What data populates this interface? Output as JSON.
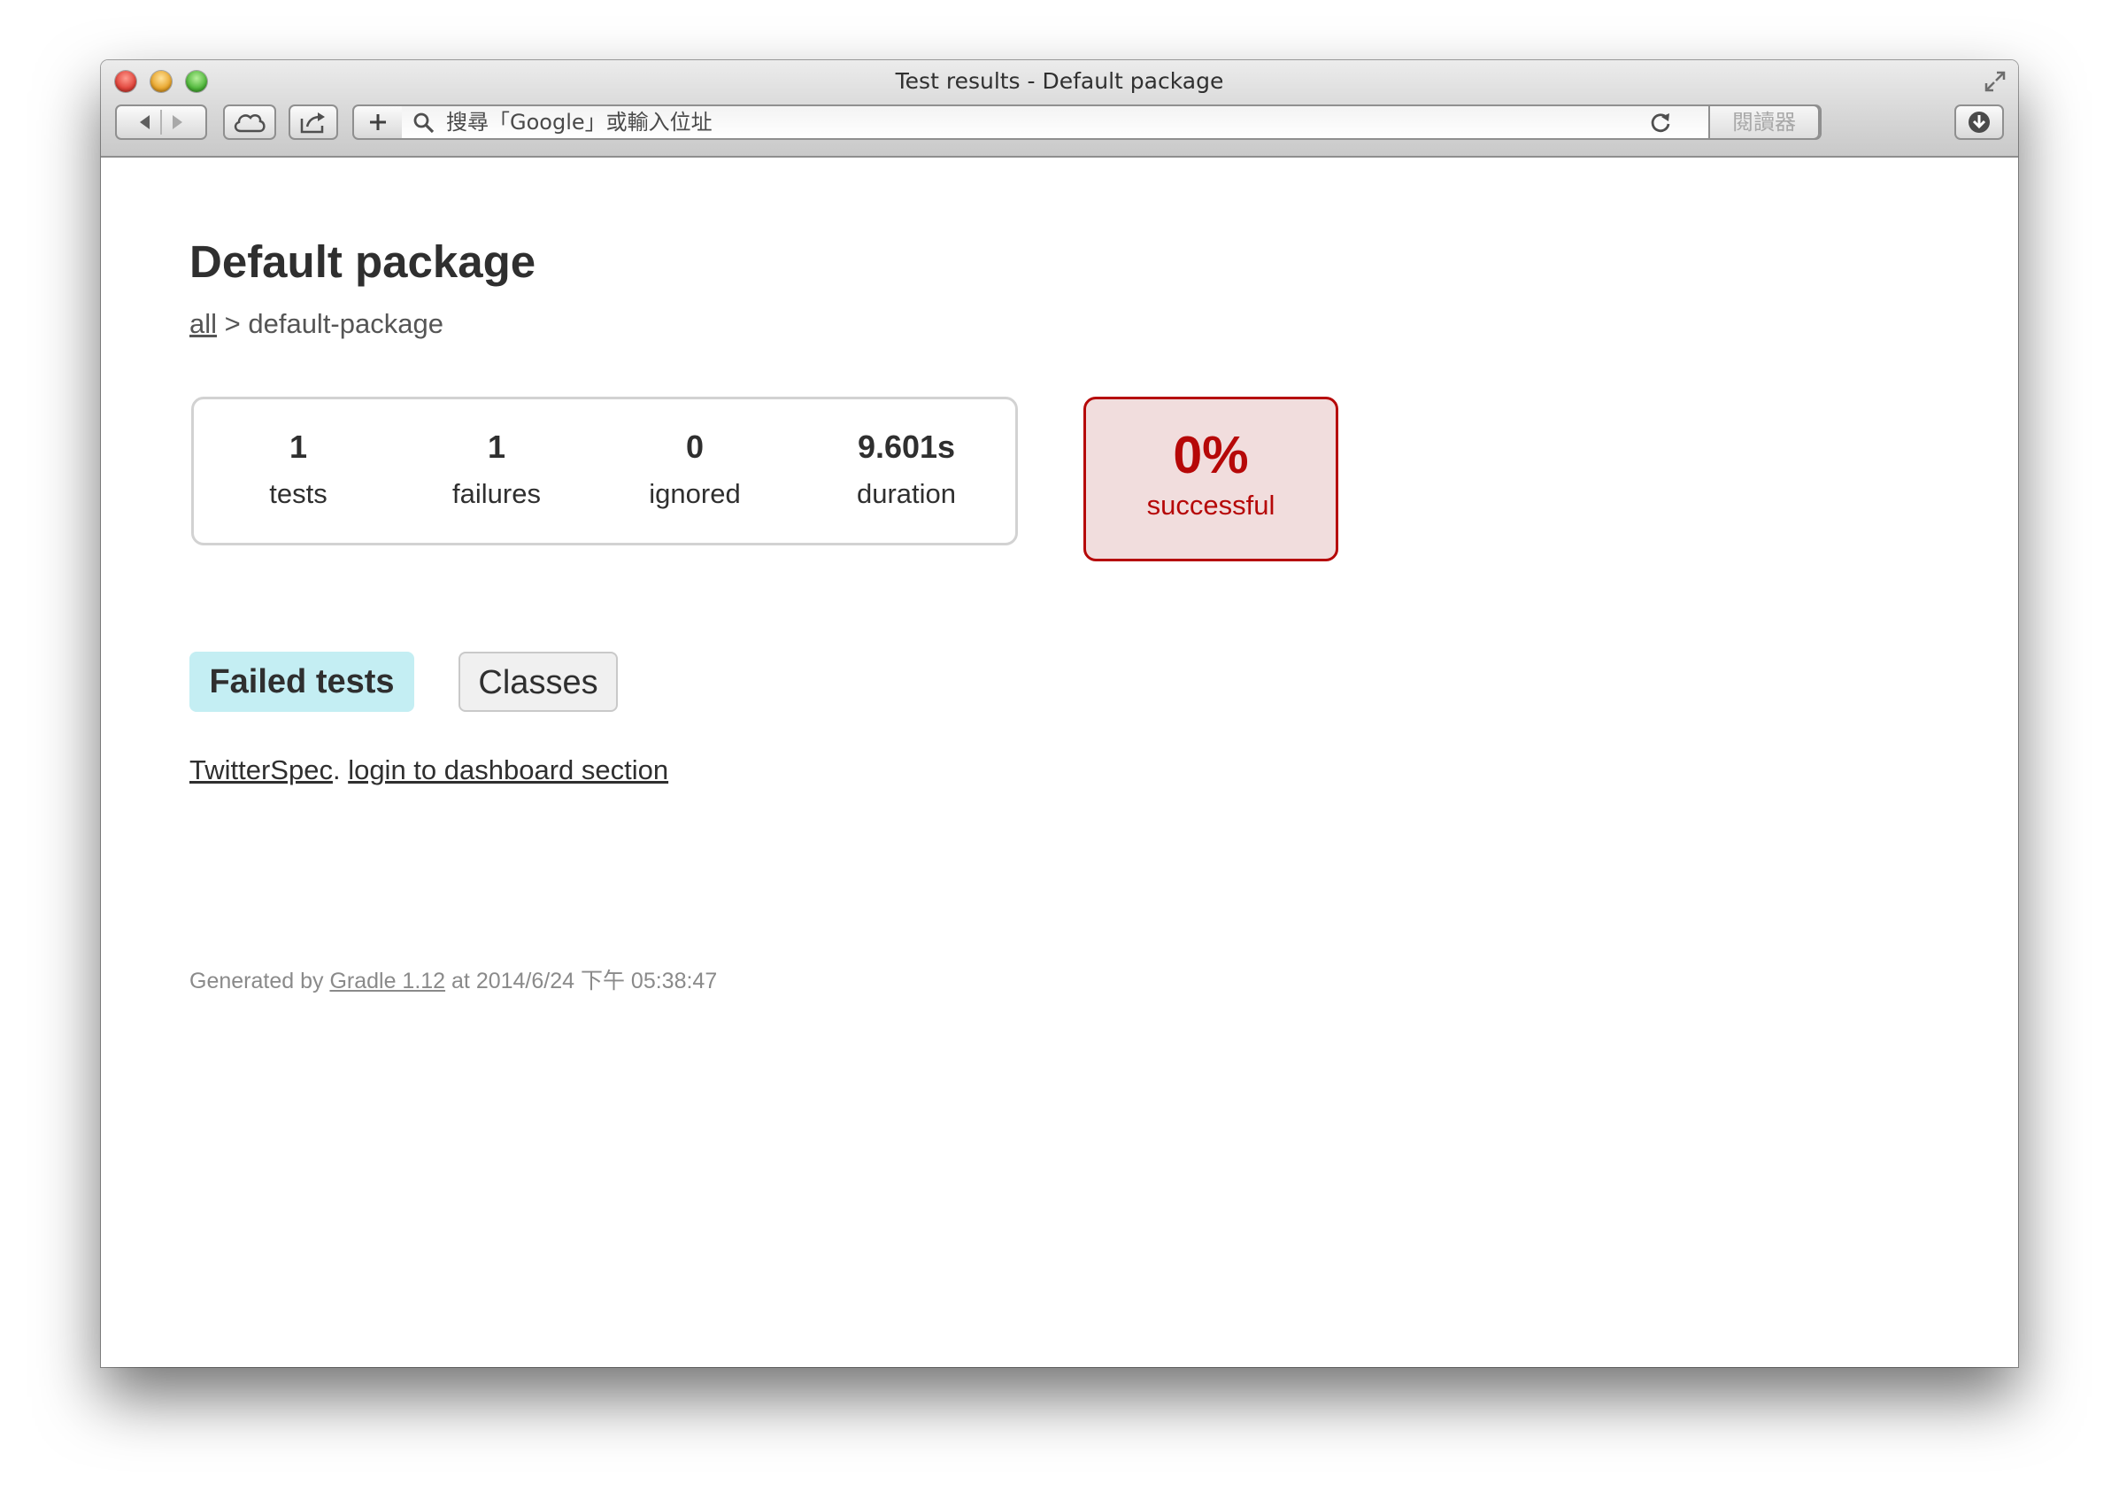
{
  "window": {
    "title": "Test results - Default package"
  },
  "toolbar": {
    "address_placeholder": "搜尋「Google」或輸入位址",
    "reader_label": "閱讀器",
    "icons": {
      "back": "back-arrow-icon",
      "forward": "forward-arrow-icon",
      "cloud": "icloud-tabs-icon",
      "share": "share-icon",
      "add": "plus-icon",
      "search": "magnifier-icon",
      "reload": "reload-icon",
      "download": "download-icon",
      "fullscreen": "fullscreen-arrows-icon"
    }
  },
  "page": {
    "title": "Default package",
    "breadcrumb": {
      "root_link": "all",
      "separator": " > ",
      "current": "default-package"
    },
    "summary": {
      "tests": {
        "value": "1",
        "label": "tests"
      },
      "failures": {
        "value": "1",
        "label": "failures"
      },
      "ignored": {
        "value": "0",
        "label": "ignored"
      },
      "duration": {
        "value": "9.601s",
        "label": "duration"
      }
    },
    "success_rate": {
      "value": "0%",
      "label": "successful"
    },
    "tabs": [
      {
        "label": "Failed tests",
        "active": true
      },
      {
        "label": "Classes",
        "active": false
      }
    ],
    "failed_tests": [
      {
        "class": "TwitterSpec",
        "separator": ". ",
        "test": "login to dashboard section"
      }
    ],
    "footer": {
      "prefix": "Generated by ",
      "tool_link": "Gradle 1.12",
      "suffix": " at 2014/6/24 下午 05:38:47"
    }
  },
  "colors": {
    "failure_red": "#b60808",
    "failure_bg": "#f1dddd",
    "active_tab_bg": "#c4eef3",
    "text_dark": "#2f2f2f",
    "footer_gray": "#8a8a8a"
  }
}
